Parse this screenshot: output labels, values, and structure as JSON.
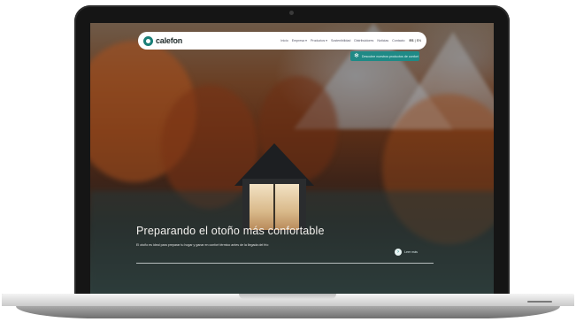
{
  "site": {
    "logo_text": "calefon",
    "nav": {
      "items": [
        "Inicio",
        "Empresa ▾",
        "Productos ▾",
        "Sostenibilidad",
        "Distribuidores",
        "Noticias",
        "Contacto"
      ],
      "lang_active": "ES",
      "lang_other": "EN"
    },
    "promo": {
      "icon": "snowflake-icon",
      "text": "Descubre nuestros productos de confort"
    },
    "hero": {
      "title": "Preparando el otoño más confortable",
      "subtitle": "El otoño es ideal para preparar tu hogar y ganar en confort térmico antes de la llegada del frío",
      "cta_label": "Leer más"
    }
  },
  "colors": {
    "accent": "#1f8a86",
    "laptop_frame": "#151515"
  }
}
